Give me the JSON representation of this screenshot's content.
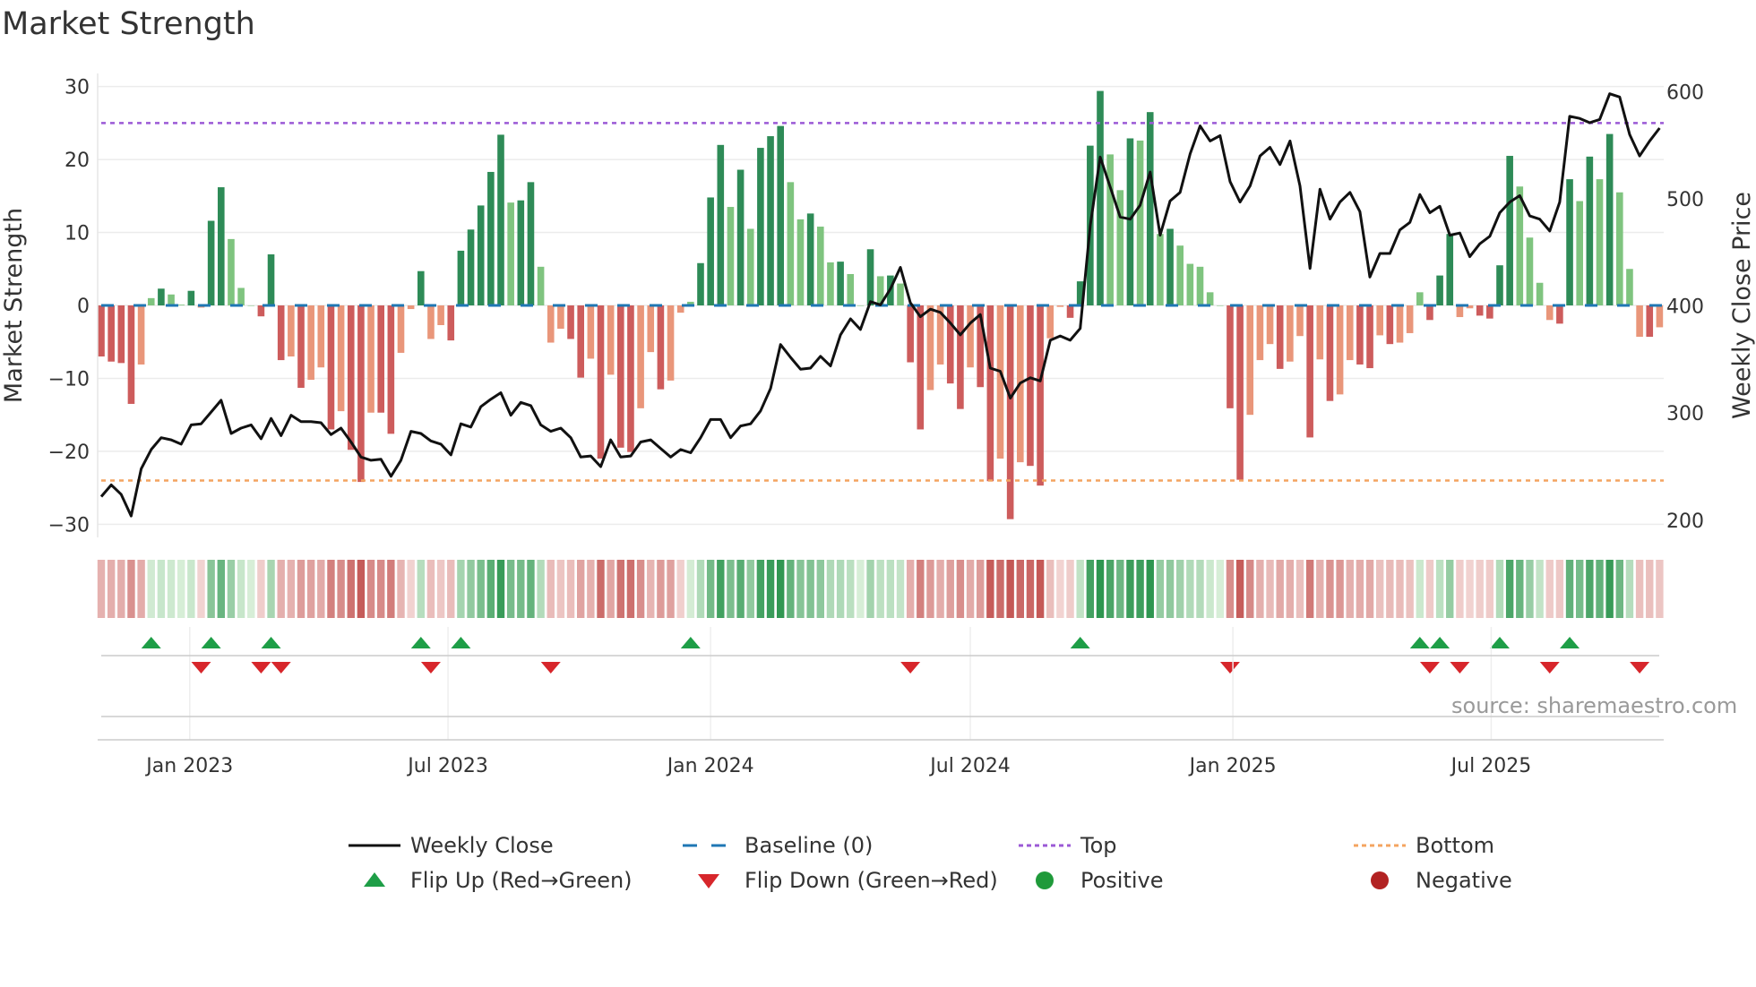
{
  "chart_data": {
    "type": "bar+line",
    "title": "Market Strength",
    "ylabel_left": "Market Strength",
    "ylabel_right": "Weekly Close Price",
    "x_start": "2022-10-31",
    "x_step_days": 7,
    "xticks": [
      {
        "label": "Jan 2023",
        "date": "2023-01-01"
      },
      {
        "label": "Jul 2023",
        "date": "2023-07-01"
      },
      {
        "label": "Jan 2024",
        "date": "2024-01-01"
      },
      {
        "label": "Jul 2024",
        "date": "2024-07-01"
      },
      {
        "label": "Jan 2025",
        "date": "2025-01-01"
      },
      {
        "label": "Jul 2025",
        "date": "2025-07-01"
      }
    ],
    "yticks_left": [
      30,
      20,
      10,
      0,
      -10,
      -20,
      -30
    ],
    "yticks_left_labels": [
      "30",
      "20",
      "10",
      "0",
      "−10",
      "−20",
      "−30"
    ],
    "ylim_left": [
      -31.8,
      31.8
    ],
    "yticks_right": [
      600,
      500,
      400,
      300,
      200
    ],
    "yticks_right_labels": [
      "600",
      "500",
      "400",
      "300",
      "200"
    ],
    "ylim_right": [
      184,
      617
    ],
    "top_level": 25,
    "bottom_level": -24,
    "baseline": 0,
    "strength": [
      -7.0,
      -7.7,
      -7.9,
      -13.5,
      -8.1,
      1.0,
      2.3,
      1.5,
      0.1,
      2.0,
      -0.3,
      11.6,
      16.2,
      9.1,
      2.4,
      0,
      -1.5,
      7.0,
      -7.5,
      -7.0,
      -11.3,
      -10.2,
      -8.5,
      -17.0,
      -14.5,
      -19.8,
      -24.2,
      -14.7,
      -14.7,
      -17.6,
      -6.5,
      -0.5,
      4.7,
      -4.6,
      -2.7,
      -4.8,
      7.5,
      10.4,
      13.7,
      18.3,
      23.4,
      14.1,
      14.4,
      16.9,
      5.3,
      -5.1,
      -3.2,
      -4.6,
      -9.9,
      -7.3,
      -21.0,
      -9.5,
      -19.5,
      -20.1,
      -14.1,
      -6.4,
      -11.5,
      -10.3,
      -1.0,
      0.5,
      5.8,
      14.8,
      22.0,
      13.5,
      18.6,
      10.5,
      21.6,
      23.2,
      24.6,
      16.9,
      11.8,
      12.6,
      10.8,
      5.9,
      6.0,
      4.3,
      0,
      7.7,
      4.0,
      4.1,
      3.0,
      -7.8,
      -17.0,
      -11.6,
      -8.1,
      -10.7,
      -14.2,
      -8.5,
      -11.2,
      -24.1,
      -21.0,
      -29.3,
      -21.5,
      -22.0,
      -24.7,
      -4.5,
      -0.2,
      -1.7,
      3.3,
      21.9,
      29.4,
      20.7,
      15.8,
      22.9,
      22.6,
      26.5,
      9.8,
      10.5,
      8.2,
      5.7,
      5.3,
      1.8,
      0,
      -14.1,
      -23.9,
      -15.0,
      -7.5,
      -5.3,
      -8.7,
      -7.7,
      -4.2,
      -18.1,
      -7.4,
      -13.1,
      -12.2,
      -7.5,
      -8.1,
      -8.6,
      -4.1,
      -5.3,
      -5.1,
      -3.8,
      1.8,
      -2.0,
      4.1,
      9.8,
      -1.6,
      -0.4,
      -1.4,
      -1.8,
      5.5,
      20.5,
      16.3,
      9.3,
      3.1,
      -2.0,
      -2.5,
      17.3,
      14.3,
      20.4,
      17.3,
      23.5,
      15.5,
      5.0,
      -4.3,
      -4.3,
      -3.0
    ],
    "weekly_close": [
      222,
      233,
      224,
      204,
      248,
      266,
      277,
      275,
      271,
      289,
      290,
      301,
      312,
      281,
      286,
      289,
      276,
      295,
      279,
      298,
      292,
      292,
      291,
      280,
      286,
      273,
      259,
      256,
      257,
      241,
      256,
      283,
      281,
      274,
      271,
      261,
      290,
      287,
      306,
      313,
      319,
      298,
      310,
      307,
      289,
      283,
      286,
      277,
      259,
      260,
      250,
      275,
      259,
      260,
      273,
      275,
      267,
      259,
      266,
      263,
      277,
      294,
      294,
      277,
      288,
      290,
      302,
      323,
      364,
      352,
      341,
      342,
      353,
      344,
      373,
      388,
      378,
      404,
      401,
      416,
      436,
      403,
      390,
      397,
      394,
      384,
      373,
      384,
      392,
      342,
      339,
      314,
      328,
      333,
      330,
      368,
      372,
      368,
      379,
      475,
      539,
      511,
      483,
      481,
      494,
      525,
      466,
      498,
      506,
      542,
      568,
      554,
      559,
      516,
      497,
      512,
      540,
      548,
      532,
      554,
      512,
      435,
      509,
      481,
      497,
      506,
      488,
      427,
      449,
      449,
      471,
      478,
      504,
      487,
      493,
      466,
      468,
      446,
      458,
      465,
      487,
      497,
      503,
      484,
      481,
      470,
      497,
      577,
      575,
      571,
      574,
      598,
      595,
      560,
      540,
      554,
      566
    ],
    "flip_up": [
      5,
      11,
      17,
      32,
      36,
      59,
      98,
      132,
      134,
      140,
      147
    ],
    "flip_down": [
      10,
      16,
      18,
      33,
      45,
      81,
      113,
      133,
      136,
      145,
      154
    ],
    "legend": [
      {
        "label": "Weekly Close",
        "icon": "line-sample",
        "color": "#111111"
      },
      {
        "label": "Baseline (0)",
        "icon": "dashed-line-sample",
        "color": "#1f77b4"
      },
      {
        "label": "Top",
        "icon": "dotted-line-sample",
        "color": "#9b59d6"
      },
      {
        "label": "Bottom",
        "icon": "dotted-line-sample",
        "color": "#f4a460"
      },
      {
        "label": "Flip Up (Red→Green)",
        "icon": "triangle-up",
        "color": "#1e9e47"
      },
      {
        "label": "Flip Down (Green→Red)",
        "icon": "triangle-down",
        "color": "#d7262b"
      },
      {
        "label": "Positive",
        "icon": "circle",
        "color": "#1f9a3a"
      },
      {
        "label": "Negative",
        "icon": "circle",
        "color": "#b22222"
      }
    ],
    "legend_placement": "bottom",
    "grid": true,
    "colors": {
      "pos_strong": "#2e8b57",
      "pos_weak": "#7fc47f",
      "neg_strong": "#cd5c5c",
      "neg_weak": "#e9967a",
      "baseline": "#1f77b4",
      "top": "#9b59d6",
      "bottom": "#f4a460",
      "line": "#111111"
    },
    "source": "source: sharemaestro.com"
  }
}
